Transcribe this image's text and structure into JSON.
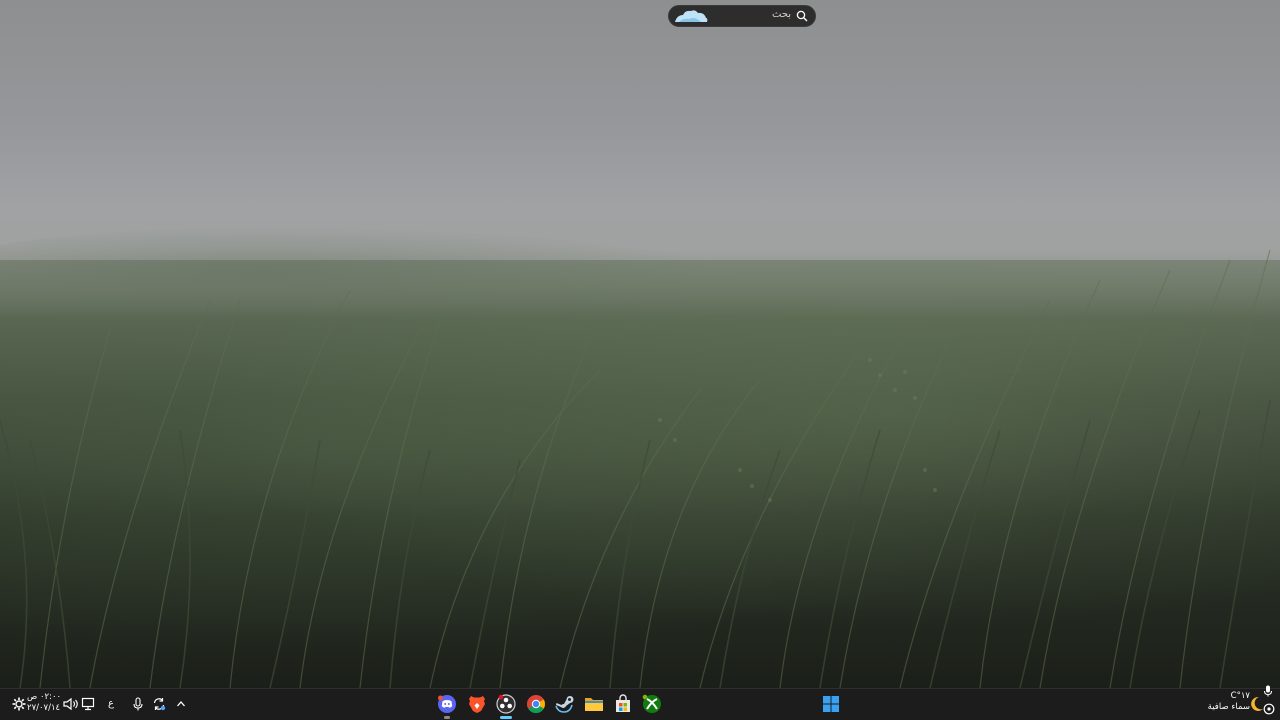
{
  "taskbar": {
    "search": {
      "label": "بحث"
    },
    "clock": {
      "time": "٠٢:٠٠ ص",
      "date": "٢٧/٠٧/١٤"
    },
    "language": "ع",
    "weather": {
      "temperature": "١٧°C",
      "condition": "سماء صافية"
    },
    "apps": [
      {
        "name": "discord",
        "icon": "discord-icon",
        "running": true,
        "badge": true
      },
      {
        "name": "brave",
        "icon": "brave-icon",
        "running": false
      },
      {
        "name": "obs-studio",
        "icon": "obs-icon",
        "running": true,
        "active": true
      },
      {
        "name": "chrome",
        "icon": "chrome-icon",
        "running": false
      },
      {
        "name": "steam",
        "icon": "steam-icon",
        "running": false
      },
      {
        "name": "file-explorer",
        "icon": "folder-icon",
        "running": false
      },
      {
        "name": "microsoft-store",
        "icon": "store-icon",
        "running": false
      },
      {
        "name": "xbox",
        "icon": "xbox-icon",
        "running": false
      }
    ],
    "colors": {
      "background": "#1c1c1c",
      "accent": "#60cdff",
      "windows_logo": "#3aa0f0"
    }
  }
}
